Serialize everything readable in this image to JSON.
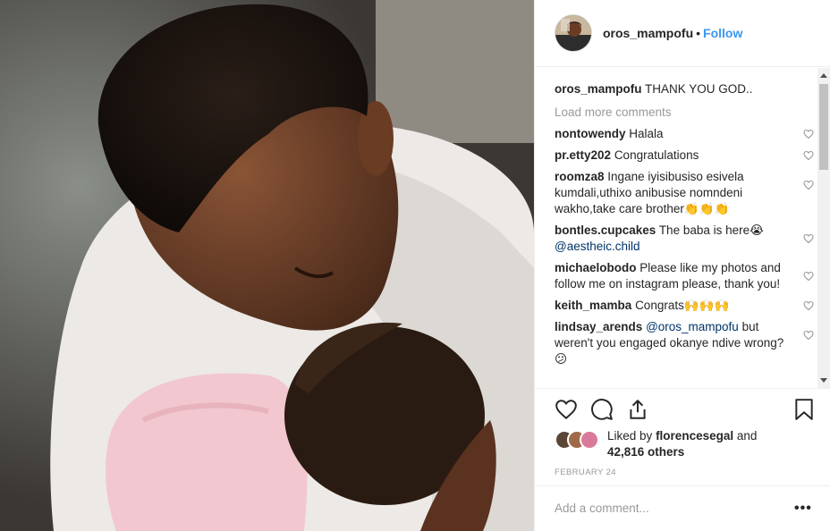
{
  "post": {
    "author": "oros_mampofu",
    "separator": "•",
    "follow_label": "Follow",
    "caption_user": "oros_mampofu",
    "caption_text": "THANK YOU GOD.."
  },
  "comments_section": {
    "load_more_label": "Load more comments",
    "comments": [
      {
        "user": "nontowendy",
        "text": "Halala"
      },
      {
        "user": "pr.etty202",
        "text": "Congratulations"
      },
      {
        "user": "roomza8",
        "text": "Ingane iyisibusiso esivela kumdali,uthixo anibusise nomndeni wakho,take care brother👏👏👏"
      },
      {
        "user": "bontles.cupcakes",
        "text": "The baba is here😭",
        "mention": "@aestheic.child"
      },
      {
        "user": "michaelobodo",
        "text": "Please like my photos and follow me on instagram please, thank you!"
      },
      {
        "user": "keith_mamba",
        "text": "Congrats🙌🙌🙌"
      },
      {
        "user": "lindsay_arends",
        "mention": "@oros_mampofu",
        "text": "but weren't you engaged okanye ndive wrong?😕"
      }
    ]
  },
  "likes": {
    "prefix": "Liked by",
    "liker": "florencesegal",
    "conjunction": "and",
    "others": "42,816 others"
  },
  "date": "FEBRUARY 24",
  "add_comment": {
    "placeholder": "Add a comment..."
  },
  "more_options": "•••",
  "icons": [
    "heart-icon",
    "comment-icon",
    "share-icon",
    "bookmark-icon",
    "small-heart-icon"
  ],
  "colors": {
    "link": "#3897f0",
    "mention": "#003569",
    "muted": "#999999"
  }
}
